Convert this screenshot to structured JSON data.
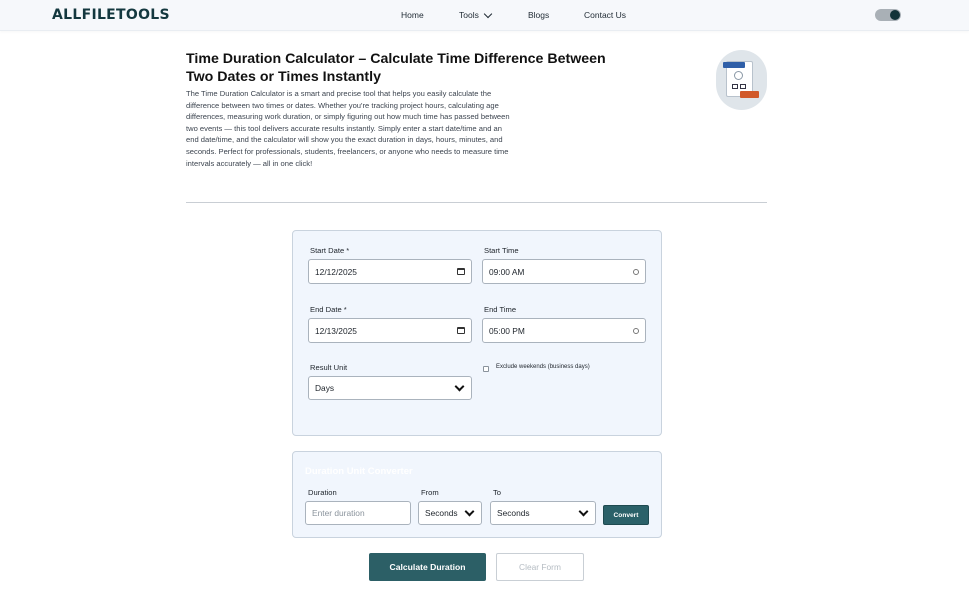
{
  "header": {
    "logo": "ALLFILETOOLS",
    "nav": {
      "home": "Home",
      "tools": "Tools",
      "blogs": "Blogs",
      "contact": "Contact Us"
    },
    "theme_toggle": "on"
  },
  "hero": {
    "title": "Time Duration Calculator – Calculate Time Difference Between Two Dates or Times Instantly",
    "description": "The Time Duration Calculator is a smart and precise tool that helps you easily calculate the difference between two times or dates. Whether you're tracking project hours, calculating age differences, measuring work duration, or simply figuring out how much time has passed between two events — this tool delivers accurate results instantly. Simply enter a start date/time and an end date/time, and the calculator will show you the exact duration in days, hours, minutes, and seconds. Perfect for professionals, students, freelancers, or anyone who needs to measure time intervals accurately — all in one click!",
    "badge_top": "Calculator",
    "badge_bottom": "Duration"
  },
  "form": {
    "start_date_label": "Start Date *",
    "start_date_value": "12/12/2025",
    "start_time_label": "Start Time",
    "start_time_value": "09:00 AM",
    "end_date_label": "End Date *",
    "end_date_value": "12/13/2025",
    "end_time_label": "End Time",
    "end_time_value": "05:00 PM",
    "result_unit_label": "Result Unit",
    "result_unit_value": "Days",
    "exclude_weekends_label": "Exclude weekends (business days)",
    "exclude_weekends_checked": false
  },
  "converter": {
    "title": "Duration Unit Converter",
    "duration_label": "Duration",
    "duration_placeholder": "Enter duration",
    "from_label": "From",
    "from_value": "Seconds",
    "to_label": "To",
    "to_value": "Seconds",
    "convert_button": "Convert"
  },
  "actions": {
    "calculate": "Calculate Duration",
    "clear": "Clear Form"
  },
  "colors": {
    "brand": "#14383f",
    "primary_button": "#2c5f66",
    "panel_bg": "#f1f6fd"
  }
}
